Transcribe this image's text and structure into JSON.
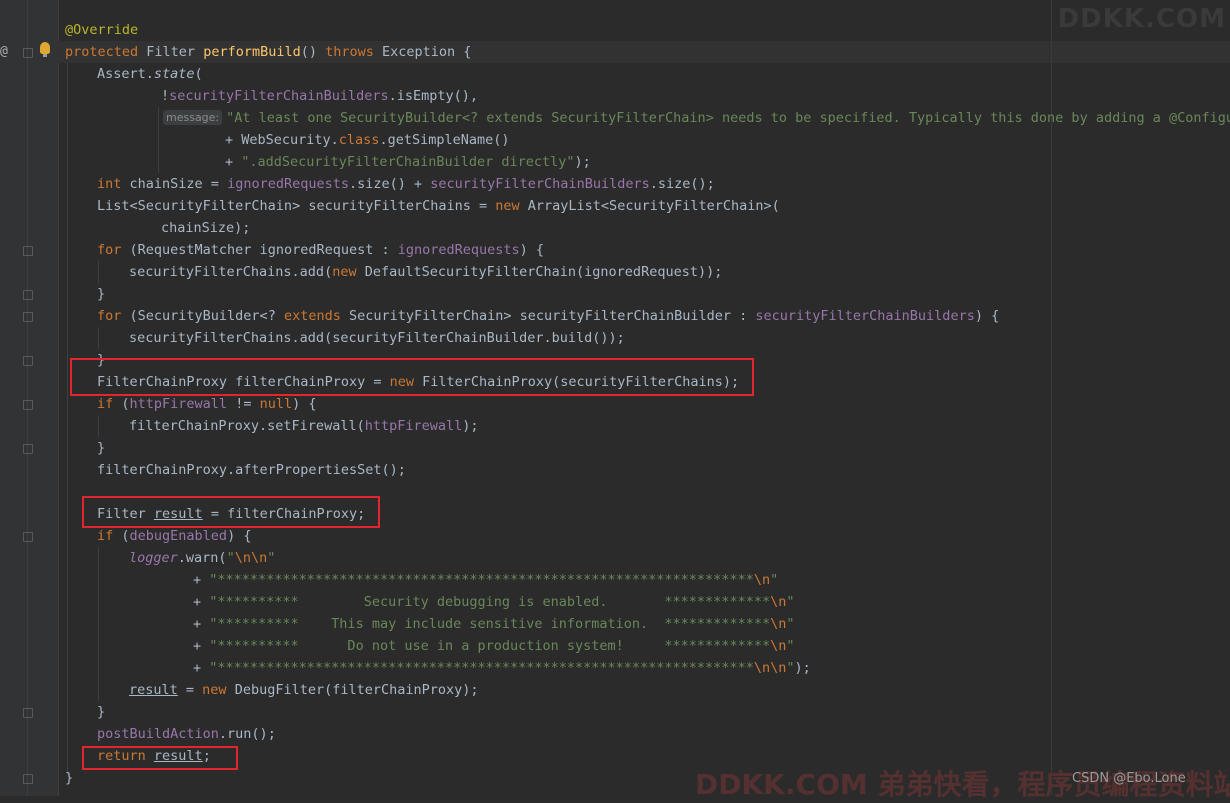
{
  "code": {
    "annotation": "@Override",
    "l1": {
      "kw1": "protected",
      "t1": " Filter ",
      "method": "performBuild",
      "t2": "() ",
      "kw2": "throws",
      "t3": " Exception {"
    },
    "l2": {
      "t1": "Assert.",
      "m": "state",
      "t2": "("
    },
    "l3": {
      "t1": "!",
      "f": "securityFilterChainBuilders",
      "t2": ".isEmpty(),"
    },
    "l4": {
      "hint": "message:",
      "s": "\"At least one SecurityBuilder<? extends SecurityFilterChain> needs to be specified. Typically this done by adding a @Configur"
    },
    "l5": {
      "t1": "+ WebSecurity.",
      "kw": "class",
      "t2": ".getSimpleName()"
    },
    "l6": {
      "t1": "+ ",
      "s": "\".addSecurityFilterChainBuilder directly\"",
      "t2": ");"
    },
    "l7": {
      "kw": "int",
      "t1": " chainSize = ",
      "f1": "ignoredRequests",
      "t2": ".size() + ",
      "f2": "securityFilterChainBuilders",
      "t3": ".size();"
    },
    "l8": {
      "t1": "List<SecurityFilterChain> securityFilterChains = ",
      "kw": "new",
      "t2": " ArrayList<SecurityFilterChain>("
    },
    "l9": {
      "t1": "chainSize);"
    },
    "l10": {
      "kw": "for",
      "t1": " (RequestMatcher ignoredRequest : ",
      "f": "ignoredRequests",
      "t2": ") {"
    },
    "l11": {
      "t1": "securityFilterChains.add(",
      "kw": "new",
      "t2": " DefaultSecurityFilterChain(ignoredRequest));"
    },
    "l12": {
      "t1": "}"
    },
    "l13": {
      "kw1": "for",
      "t1": " (SecurityBuilder<? ",
      "kw2": "extends",
      "t2": " SecurityFilterChain> securityFilterChainBuilder : ",
      "f": "securityFilterChainBuilders",
      "t3": ") {"
    },
    "l14": {
      "t1": "securityFilterChains.add(securityFilterChainBuilder.build());"
    },
    "l15": {
      "t1": "}"
    },
    "l16": {
      "t1": "FilterChainProxy filterChainProxy = ",
      "kw": "new",
      "t2": " FilterChainProxy(securityFilterChains);"
    },
    "l17": {
      "kw1": "if",
      "t1": " (",
      "f": "httpFirewall",
      "t2": " != ",
      "kw2": "null",
      "t3": ") {"
    },
    "l18": {
      "t1": "filterChainProxy.setFirewall(",
      "f": "httpFirewall",
      "t2": ");"
    },
    "l19": {
      "t1": "}"
    },
    "l20": {
      "t1": "filterChainProxy.afterPropertiesSet();"
    },
    "l22": {
      "t1": "Filter ",
      "v": "result",
      "t2": " = filterChainProxy;"
    },
    "l23": {
      "kw": "if",
      "t1": " (",
      "f": "debugEnabled",
      "t2": ") {"
    },
    "l24": {
      "f": "logger",
      "t1": ".warn(",
      "s": "\"",
      "e": "\\n\\n",
      "s2": "\""
    },
    "l25": {
      "t1": "+ ",
      "s": "\"******************************************************************",
      "e": "\\n",
      "s2": "\""
    },
    "l26": {
      "t1": "+ ",
      "s": "\"**********        Security debugging is enabled.       *************",
      "e": "\\n",
      "s2": "\""
    },
    "l27": {
      "t1": "+ ",
      "s": "\"**********    This may include sensitive information.  *************",
      "e": "\\n",
      "s2": "\""
    },
    "l28": {
      "t1": "+ ",
      "s": "\"**********      Do not use in a production system!     *************",
      "e": "\\n",
      "s2": "\""
    },
    "l29": {
      "t1": "+ ",
      "s": "\"******************************************************************",
      "e": "\\n\\n",
      "s2": "\"",
      "t2": ");"
    },
    "l30": {
      "v": "result",
      "t1": " = ",
      "kw": "new",
      "t2": " DebugFilter(filterChainProxy);"
    },
    "l31": {
      "t1": "}"
    },
    "l32": {
      "f": "postBuildAction",
      "t1": ".run();"
    },
    "l33": {
      "kw": "return",
      "t1": " ",
      "v": "result",
      "t2": ";"
    },
    "l34": {
      "t1": "}"
    }
  },
  "gutter": {
    "at_symbol": "@"
  },
  "watermark": {
    "top": "DDKK.COM",
    "bottom": "DDKK.COM 弟弟快看，程序员编程资料站",
    "csdn": "CSDN @Ebo.Lone"
  },
  "colors": {
    "keyword": "#cc7832",
    "string": "#6a8759",
    "field": "#9876aa",
    "method": "#ffc66d",
    "annotation": "#bbb529",
    "highlight_box": "#e3262d"
  }
}
